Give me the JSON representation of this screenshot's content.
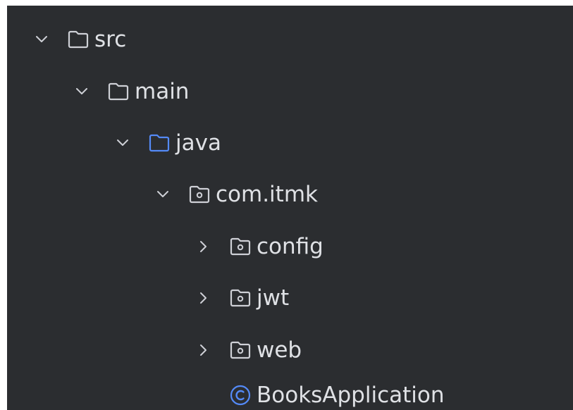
{
  "tree": {
    "items": [
      {
        "label": "src",
        "state": "expanded",
        "icon": "folder-icon"
      },
      {
        "label": "main",
        "state": "expanded",
        "icon": "folder-icon"
      },
      {
        "label": "java",
        "state": "expanded",
        "icon": "source-folder-icon"
      },
      {
        "label": "com.itmk",
        "state": "expanded",
        "icon": "package-icon"
      },
      {
        "label": "config",
        "state": "collapsed",
        "icon": "package-icon"
      },
      {
        "label": "jwt",
        "state": "collapsed",
        "icon": "package-icon"
      },
      {
        "label": "web",
        "state": "collapsed",
        "icon": "package-icon"
      },
      {
        "label": "BooksApplication",
        "state": "leaf",
        "icon": "class-icon"
      }
    ]
  },
  "colors": {
    "background": "#2b2d30",
    "text": "#dfe1e5",
    "icon_gray": "#ced0d6",
    "source_folder_blue": "#548af7",
    "class_icon_blue": "#548af7"
  }
}
